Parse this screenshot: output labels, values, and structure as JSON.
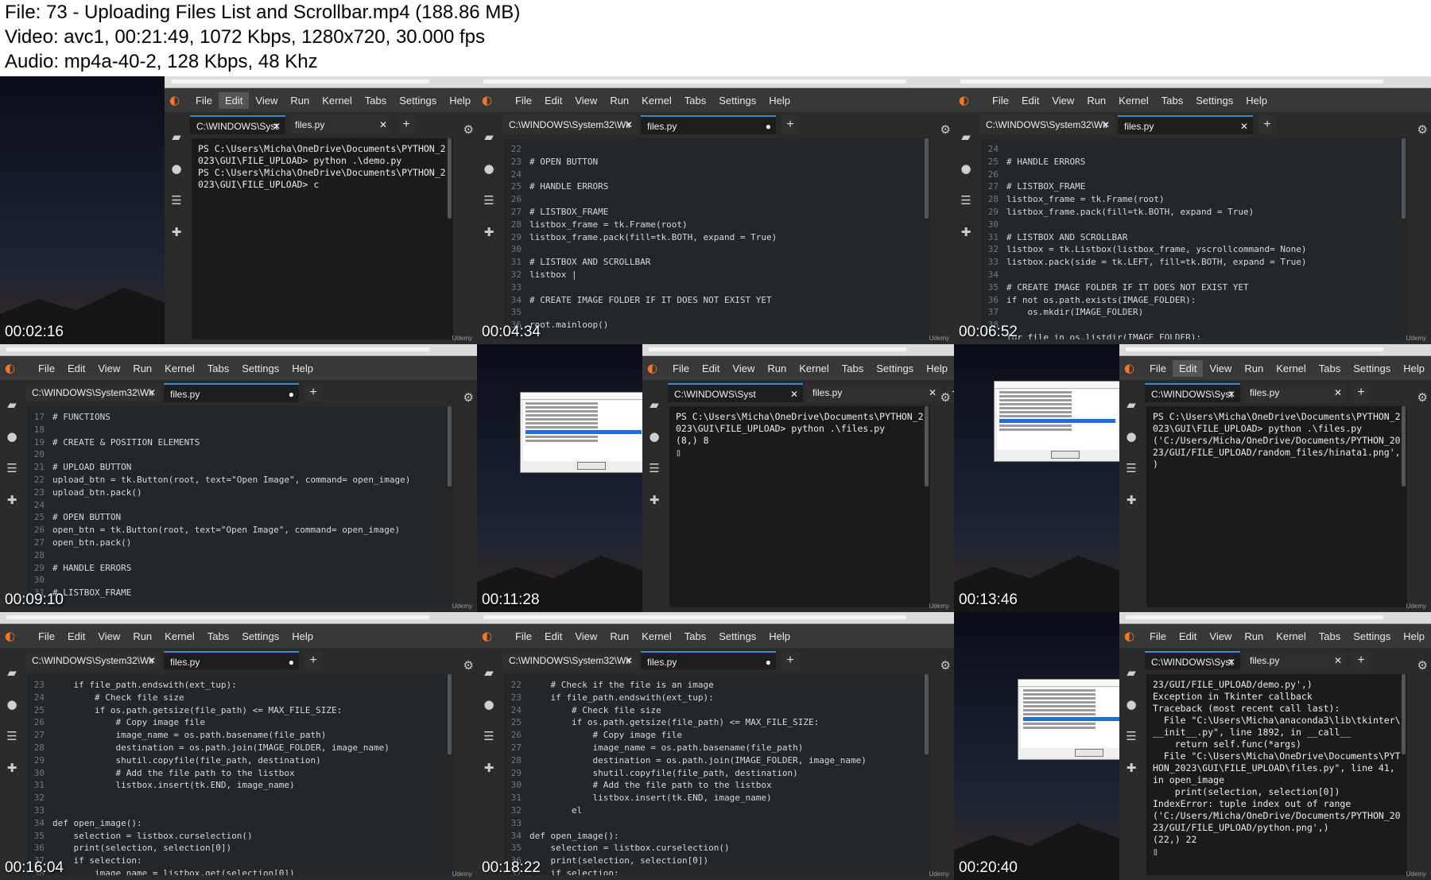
{
  "file_info": {
    "line1": "File: 73 - Uploading Files List and Scrollbar.mp4 (188.86 MB)",
    "line2": "Video: avc1, 00:21:49, 1072 Kbps, 1280x720, 30.000 fps",
    "line3": "Audio: mp4a-40-2, 128 Kbps, 48 Khz"
  },
  "ide": {
    "logo": "◐",
    "menu": [
      "File",
      "Edit",
      "View",
      "Run",
      "Kernel",
      "Tabs",
      "Settings",
      "Help"
    ],
    "sidebar_icons": [
      "folder-icon",
      "stop-circle-icon",
      "list-icon",
      "puzzle-icon"
    ],
    "gear": "⚙",
    "plus": "+",
    "watermark": "Udemy"
  },
  "frames": [
    {
      "timestamp": "00:02:16",
      "tab1": "C:\\WINDOWS\\Syst",
      "tab2": "files.py",
      "tab2_close": "✕",
      "content": "PS C:\\Users\\Micha\\OneDrive\\Documents\\PYTHON_2\n023\\GUI\\FILE_UPLOAD> python .\\demo.py\nPS C:\\Users\\Micha\\OneDrive\\Documents\\PYTHON_2\n023\\GUI\\FILE_UPLOAD> c"
    },
    {
      "timestamp": "00:04:34",
      "tab1": "C:\\WINDOWS\\System32\\Wir",
      "tab2": "files.py",
      "tab2_close": "●",
      "lines": "22\n23\n24\n25\n26\n27\n28\n29\n30\n31\n32\n33\n34\n35\n36",
      "content": "\n# OPEN BUTTON\n\n# HANDLE ERRORS\n\n# LISTBOX_FRAME\nlistbox_frame = tk.Frame(root)\nlistbox_frame.pack(fill=tk.BOTH, expand = True)\n\n# LISTBOX AND SCROLLBAR\nlistbox |\n\n# CREATE IMAGE FOLDER IF IT DOES NOT EXIST YET\n\nroot.mainloop()"
    },
    {
      "timestamp": "00:06:52",
      "tab1": "C:\\WINDOWS\\System32\\Wir",
      "tab2": "files.py",
      "tab2_close": "✕",
      "lines": "24\n25\n26\n27\n28\n29\n30\n31\n32\n33\n34\n35\n36\n37\n38",
      "content": "\n# HANDLE ERRORS\n\n# LISTBOX_FRAME\nlistbox_frame = tk.Frame(root)\nlistbox_frame.pack(fill=tk.BOTH, expand = True)\n\n# LISTBOX AND SCROLLBAR\nlistbox = tk.Listbox(listbox_frame, yscrollcommand= None)\nlistbox.pack(side = tk.LEFT, fill=tk.BOTH, expand = True)\n\n# CREATE IMAGE FOLDER IF IT DOES NOT EXIST YET\nif not os.path.exists(IMAGE_FOLDER):\n    os.mkdir(IMAGE_FOLDER)\n\nfor file in os.listdir(IMAGE_FOLDER):"
    },
    {
      "timestamp": "00:09:10",
      "tab1": "C:\\WINDOWS\\System32\\Wir",
      "tab2": "files.py",
      "tab2_close": "●",
      "lines": "17\n18\n19\n20\n21\n22\n23\n24\n25\n26\n27\n28\n29\n30\n31",
      "content": "# FUNCTIONS\n\n# CREATE & POSITION ELEMENTS\n\n# UPLOAD BUTTON\nupload_btn = tk.Button(root, text=\"Open Image\", command= open_image)\nupload_btn.pack()\n\n# OPEN BUTTON\nopen_btn = tk.Button(root, text=\"Open Image\", command= open_image)\nopen_btn.pack()\n\n# HANDLE ERRORS\n\n# LISTBOX_FRAME"
    },
    {
      "timestamp": "00:11:28",
      "tab1": "C:\\WINDOWS\\Syst",
      "tab2": "files.py",
      "tab2_close": "✕",
      "content": "PS C:\\Users\\Micha\\OneDrive\\Documents\\PYTHON_2\n023\\GUI\\FILE_UPLOAD> python .\\files.py\n(8,) 8\n▯"
    },
    {
      "timestamp": "00:13:46",
      "tab1": "C:\\WINDOWS\\Syst",
      "tab2": "files.py",
      "tab2_close": "✕",
      "content": "PS C:\\Users\\Micha\\OneDrive\\Documents\\PYTHON_2\n023\\GUI\\FILE_UPLOAD> python .\\files.py\n('C:/Users/Micha/OneDrive/Documents/PYTHON_20\n23/GUI/FILE_UPLOAD/random_files/hinata1.png',\n)"
    },
    {
      "timestamp": "00:16:04",
      "tab1": "C:\\WINDOWS\\System32\\Wir",
      "tab2": "files.py",
      "tab2_close": "●",
      "lines": "23\n24\n25\n26\n27\n28\n29\n30\n31\n32\n33\n34\n35\n36\n37\n38",
      "content": "    if file_path.endswith(ext_tup):\n        # Check file size\n        if os.path.getsize(file_path) <= MAX_FILE_SIZE:\n            # Copy image file\n            image_name = os.path.basename(file_path)\n            destination = os.path.join(IMAGE_FOLDER, image_name)\n            shutil.copyfile(file_path, destination)\n            # Add the file path to the listbox\n            listbox.insert(tk.END, image_name)\n\n\ndef open_image():\n    selection = listbox.curselection()\n    print(selection, selection[0])\n    if selection:\n        image_name = listbox.get(selection[0])"
    },
    {
      "timestamp": "00:18:22",
      "tab1": "C:\\WINDOWS\\System32\\Wir",
      "tab2": "files.py",
      "tab2_close": "●",
      "lines": "22\n23\n24\n25\n26\n27\n28\n29\n30\n31\n32\n33\n34\n35\n36\n37",
      "content": "    # Check if the file is an image\n    if file_path.endswith(ext_tup):\n        # Check file size\n        if os.path.getsize(file_path) <= MAX_FILE_SIZE:\n            # Copy image file\n            image_name = os.path.basename(file_path)\n            destination = os.path.join(IMAGE_FOLDER, image_name)\n            shutil.copyfile(file_path, destination)\n            # Add the file path to the listbox\n            listbox.insert(tk.END, image_name)\n        el\n\ndef open_image():\n    selection = listbox.curselection()\n    print(selection, selection[0])\n    if selection:"
    },
    {
      "timestamp": "00:20:40",
      "tab1": "C:\\WINDOWS\\Syst",
      "tab2": "files.py",
      "tab2_close": "✕",
      "content": "23/GUI/FILE_UPLOAD/demo.py',)\nException in Tkinter callback\nTraceback (most recent call last):\n  File \"C:\\Users\\Micha\\anaconda3\\lib\\tkinter\\\n__init__.py\", line 1892, in __call__\n    return self.func(*args)\n  File \"C:\\Users\\Micha\\OneDrive\\Documents\\PYT\nHON_2023\\GUI\\FILE_UPLOAD\\files.py\", line 41,\nin open_image\n    print(selection, selection[0])\nIndexError: tuple index out of range\n('C:/Users/Micha/OneDrive/Documents/PYTHON_20\n23/GUI/FILE_UPLOAD/python.png',)\n(22,) 22\n▯"
    }
  ]
}
